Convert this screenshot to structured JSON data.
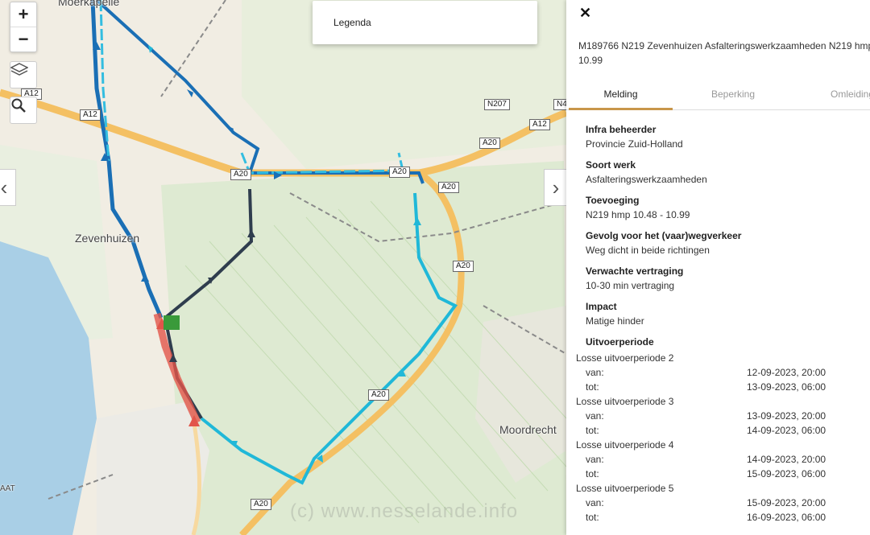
{
  "map": {
    "zoom_in": "+",
    "zoom_out": "−",
    "legend_label": "Legenda",
    "places": [
      "Moerkapelle",
      "Zevenhuizen",
      "Moordrecht",
      "AAT"
    ],
    "roads": [
      "A12",
      "A12",
      "A12",
      "A20",
      "A20",
      "A20",
      "A20",
      "A20",
      "A20",
      "N207",
      "N4",
      "A20"
    ],
    "watermark": "(c) www.nesselande.info",
    "prev_icon": "chevron-left-icon",
    "next_icon": "chevron-right-icon",
    "route_colors": {
      "main": "#1a6fb5",
      "cyan": "#20b8d8",
      "dark": "#2f3d4e",
      "closed": "#e2554a",
      "highway": "#f6c56b"
    }
  },
  "panel": {
    "close": "✕",
    "title_line1": "M189766 N219 Zevenhuizen Asfalteringswerkzaamheden N219 hmp",
    "title_line2": "10.99",
    "tabs": [
      "Melding",
      "Beperking",
      "Omleiding"
    ],
    "fields": [
      {
        "label": "Infra beheerder",
        "value": "Provincie Zuid-Holland"
      },
      {
        "label": "Soort werk",
        "value": "Asfalteringswerkzaamheden"
      },
      {
        "label": "Toevoeging",
        "value": "N219 hmp 10.48 - 10.99"
      },
      {
        "label": "Gevolg voor het (vaar)wegverkeer",
        "value": "Weg dicht in beide richtingen"
      },
      {
        "label": "Verwachte vertraging",
        "value": "10-30 min vertraging"
      },
      {
        "label": "Impact",
        "value": "Matige hinder"
      }
    ],
    "period_heading": "Uitvoerperiode",
    "periods": [
      {
        "name": "Losse uitvoerperiode 2",
        "van_label": "van:",
        "van": "12-09-2023, 20:00",
        "tot_label": "tot:",
        "tot": "13-09-2023, 06:00"
      },
      {
        "name": "Losse uitvoerperiode 3",
        "van_label": "van:",
        "van": "13-09-2023, 20:00",
        "tot_label": "tot:",
        "tot": "14-09-2023, 06:00"
      },
      {
        "name": "Losse uitvoerperiode 4",
        "van_label": "van:",
        "van": "14-09-2023, 20:00",
        "tot_label": "tot:",
        "tot": "15-09-2023, 06:00"
      },
      {
        "name": "Losse uitvoerperiode 5",
        "van_label": "van:",
        "van": "15-09-2023, 20:00",
        "tot_label": "tot:",
        "tot": "16-09-2023, 06:00"
      }
    ]
  }
}
